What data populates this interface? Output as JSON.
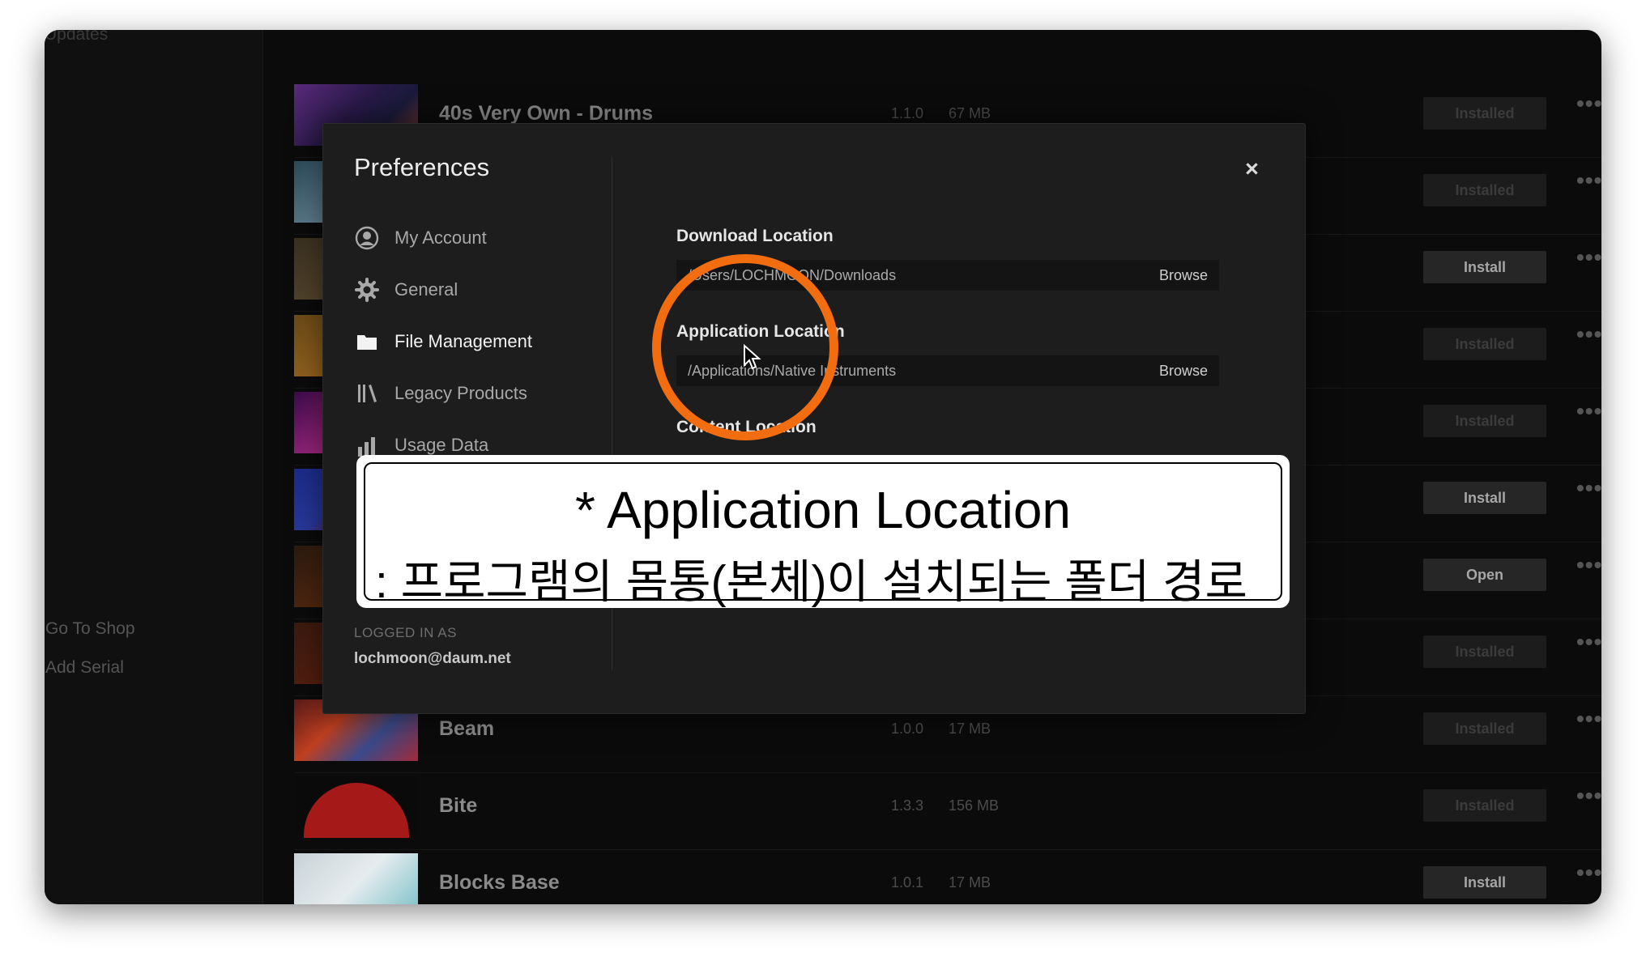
{
  "sidebar": {
    "title": "Updates",
    "links": [
      "Go To Shop",
      "Add Serial"
    ]
  },
  "products": [
    {
      "name": "40s Very Own - Drums",
      "version": "1.1.0",
      "size": "67 MB",
      "action": "Installed"
    },
    {
      "name": "",
      "version": "",
      "size": "",
      "action": "Installed"
    },
    {
      "name": "",
      "version": "",
      "size": "",
      "action": "Install"
    },
    {
      "name": "",
      "version": "",
      "size": "",
      "action": "Installed"
    },
    {
      "name": "",
      "version": "",
      "size": "",
      "action": "Installed"
    },
    {
      "name": "",
      "version": "",
      "size": "",
      "action": "Install"
    },
    {
      "name": "",
      "version": "",
      "size": "",
      "action": "Open"
    },
    {
      "name": "",
      "version": "",
      "size": "",
      "action": "Installed"
    },
    {
      "name": "Beam",
      "version": "1.0.0",
      "size": "17 MB",
      "action": "Installed"
    },
    {
      "name": "Bite",
      "version": "1.3.3",
      "size": "156 MB",
      "action": "Installed"
    },
    {
      "name": "Blocks Base",
      "version": "1.0.1",
      "size": "17 MB",
      "action": "Install"
    }
  ],
  "more_glyph": "•••",
  "preferences": {
    "title": "Preferences",
    "close_glyph": "×",
    "nav": [
      {
        "label": "My Account",
        "icon": "account-icon"
      },
      {
        "label": "General",
        "icon": "gear-icon"
      },
      {
        "label": "File Management",
        "icon": "folder-icon",
        "active": true
      },
      {
        "label": "Legacy Products",
        "icon": "library-icon"
      },
      {
        "label": "Usage Data",
        "icon": "bar-chart-icon"
      }
    ],
    "logged_in_label": "LOGGED IN AS",
    "logged_in_email": "lochmoon@daum.net",
    "download_location": {
      "label": "Download Location",
      "path": "/Users/LOCHMOON/Downloads",
      "browse": "Browse"
    },
    "application_location": {
      "label": "Application Location",
      "path": "/Applications/Native Instruments",
      "browse": "Browse"
    },
    "content_location": {
      "label": "Content Location"
    }
  },
  "caption": {
    "line1": "* Application Location",
    "line2": ": 프로그램의 몸통(본체)이 설치되는 폴더 경로"
  },
  "colors": {
    "highlight": "#f26c10",
    "background": "#0b0b0b",
    "modal": "#1d1d1d"
  }
}
